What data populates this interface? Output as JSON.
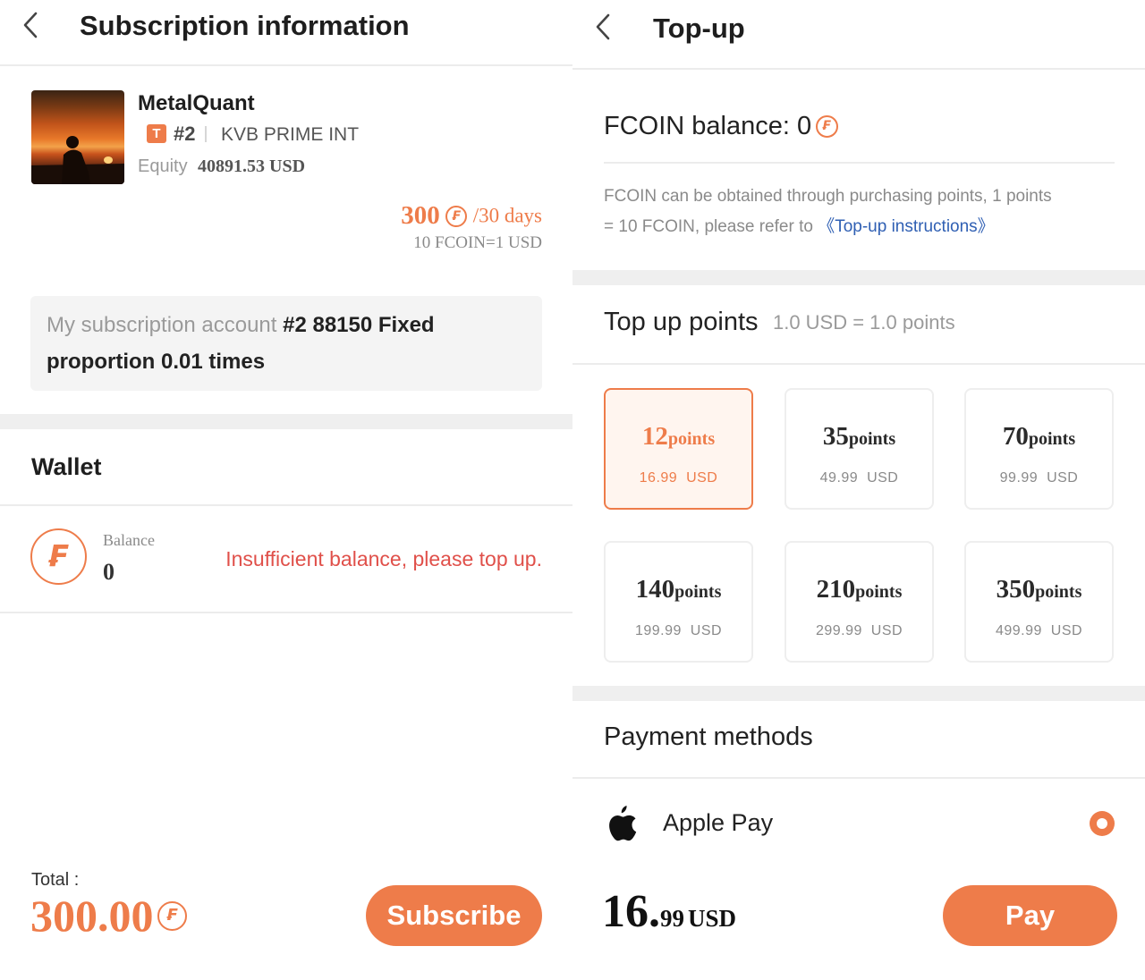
{
  "colors": {
    "accent": "#ee7c4a",
    "warning": "#e0504a",
    "link": "#2f5fb3",
    "muted": "#9a9a9a"
  },
  "subscription": {
    "header": {
      "title": "Subscription information",
      "back_icon": "chevron-left-icon"
    },
    "strategy": {
      "name": "MetalQuant",
      "tag": "T",
      "account_no": "#2",
      "broker": "KVB PRIME INT",
      "equity_label": "Equity",
      "equity_value": "40891.53 USD"
    },
    "price": {
      "amount": "300",
      "period": "/30 days",
      "rate": "10 FCOIN=1 USD"
    },
    "account_info": {
      "label": "My subscription account",
      "value_line1": "#2 88150 Fixed",
      "value_line2": "proportion 0.01 times"
    },
    "wallet": {
      "title": "Wallet",
      "balance_label": "Balance",
      "balance_value": "0",
      "warning": "Insufficient balance, please top up."
    },
    "footer": {
      "total_label": "Total :",
      "total_value": "300.00",
      "subscribe_label": "Subscribe"
    }
  },
  "topup": {
    "header": {
      "title": "Top-up",
      "back_icon": "chevron-left-icon"
    },
    "balance": {
      "label": "FCOIN balance: 0"
    },
    "note": {
      "text_line1": "FCOIN can be obtained through purchasing points, 1 points",
      "text_line2": "= 10 FCOIN, please refer to",
      "link": "《Top-up instructions》"
    },
    "points_section": {
      "title": "Top up points",
      "rate": "1.0 USD = 1.0 points"
    },
    "packages": [
      {
        "points": "12",
        "unit": "points",
        "price": "16.99  USD",
        "selected": true
      },
      {
        "points": "35",
        "unit": "points",
        "price": "49.99  USD",
        "selected": false
      },
      {
        "points": "70",
        "unit": "points",
        "price": "99.99  USD",
        "selected": false
      },
      {
        "points": "140",
        "unit": "points",
        "price": "199.99  USD",
        "selected": false
      },
      {
        "points": "210",
        "unit": "points",
        "price": "299.99  USD",
        "selected": false
      },
      {
        "points": "350",
        "unit": "points",
        "price": "499.99  USD",
        "selected": false
      }
    ],
    "payment": {
      "title": "Payment methods",
      "method": "Apple Pay",
      "method_icon": "apple-icon",
      "selected": true
    },
    "footer": {
      "amount_int": "16.",
      "amount_dec": "99",
      "currency": "USD",
      "pay_label": "Pay"
    }
  }
}
